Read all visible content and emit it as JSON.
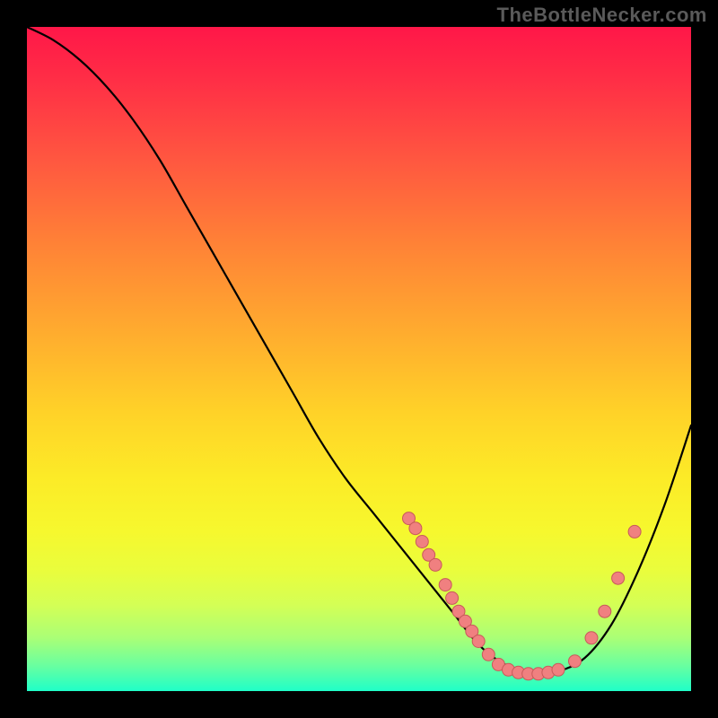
{
  "watermark": "TheBottleNecker.com",
  "chart_data": {
    "type": "line",
    "title": "",
    "xlabel": "",
    "ylabel": "",
    "xlim": [
      0,
      100
    ],
    "ylim": [
      0,
      100
    ],
    "x": [
      0,
      4,
      8,
      12,
      16,
      20,
      24,
      28,
      32,
      36,
      40,
      44,
      48,
      52,
      56,
      60,
      64,
      68,
      72,
      76,
      80,
      84,
      88,
      92,
      96,
      100
    ],
    "values": [
      100,
      98,
      95,
      91,
      86,
      80,
      73,
      66,
      59,
      52,
      45,
      38,
      32,
      27,
      22,
      17,
      12,
      7,
      4,
      3,
      3,
      5,
      10,
      18,
      28,
      40
    ],
    "scatter_points": [
      {
        "x": 57.5,
        "y": 26.0
      },
      {
        "x": 58.5,
        "y": 24.5
      },
      {
        "x": 59.5,
        "y": 22.5
      },
      {
        "x": 60.5,
        "y": 20.5
      },
      {
        "x": 61.5,
        "y": 19.0
      },
      {
        "x": 63.0,
        "y": 16.0
      },
      {
        "x": 64.0,
        "y": 14.0
      },
      {
        "x": 65.0,
        "y": 12.0
      },
      {
        "x": 66.0,
        "y": 10.5
      },
      {
        "x": 67.0,
        "y": 9.0
      },
      {
        "x": 68.0,
        "y": 7.5
      },
      {
        "x": 69.5,
        "y": 5.5
      },
      {
        "x": 71.0,
        "y": 4.0
      },
      {
        "x": 72.5,
        "y": 3.2
      },
      {
        "x": 74.0,
        "y": 2.8
      },
      {
        "x": 75.5,
        "y": 2.6
      },
      {
        "x": 77.0,
        "y": 2.6
      },
      {
        "x": 78.5,
        "y": 2.8
      },
      {
        "x": 80.0,
        "y": 3.2
      },
      {
        "x": 82.5,
        "y": 4.5
      },
      {
        "x": 85.0,
        "y": 8.0
      },
      {
        "x": 87.0,
        "y": 12.0
      },
      {
        "x": 89.0,
        "y": 17.0
      },
      {
        "x": 91.5,
        "y": 24.0
      }
    ],
    "colors": {
      "curve": "#000000",
      "points_fill": "#f08080",
      "points_stroke": "#c85a5a"
    }
  }
}
